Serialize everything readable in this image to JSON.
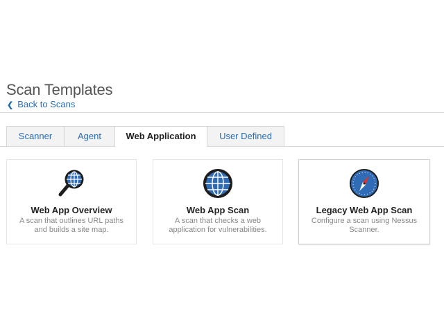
{
  "header": {
    "title": "Scan Templates",
    "back_label": "Back to Scans"
  },
  "tabs": [
    {
      "label": "Scanner",
      "active": false
    },
    {
      "label": "Agent",
      "active": false
    },
    {
      "label": "Web Application",
      "active": true
    },
    {
      "label": "User Defined",
      "active": false
    }
  ],
  "cards": [
    {
      "title": "Web App Overview",
      "description": "A scan that outlines URL paths and builds a site map.",
      "icon": "magnifier-globe-icon"
    },
    {
      "title": "Web App Scan",
      "description": "A scan that checks a web application for vulnerabilities.",
      "icon": "globe-icon"
    },
    {
      "title": "Legacy Web App Scan",
      "description": "Configure a scan using Nessus Scanner.",
      "icon": "compass-icon"
    }
  ],
  "colors": {
    "link": "#2a6db2",
    "icon_blue": "#2f6cb5",
    "icon_dark": "#1d1d1d",
    "compass_red": "#d9362b"
  }
}
